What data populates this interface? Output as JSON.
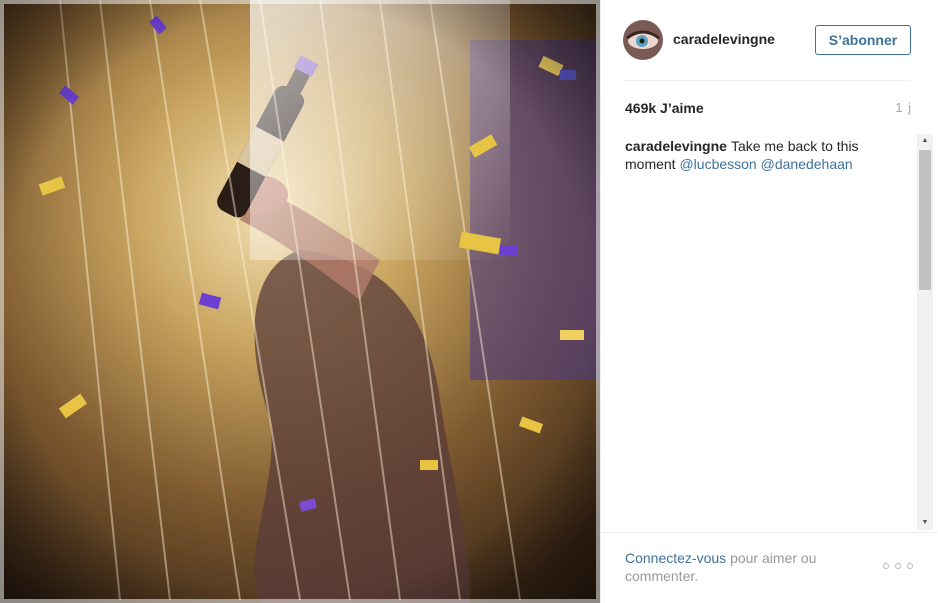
{
  "post": {
    "photo": {
      "icon": "party-photo",
      "description_visible": ""
    },
    "header": {
      "username": "caradelevingne",
      "follow_label": "S’abonner",
      "avatar_icon": "avatar-eye"
    },
    "stats": {
      "likes": "469k J’aime",
      "time": "1 j"
    },
    "caption": {
      "user": "caradelevingne",
      "text": "Take me back to this moment",
      "mentions": [
        "@lucbesson",
        "@danedehaan"
      ]
    },
    "footer": {
      "login_link": "Connectez-vous",
      "login_rest": "pour aimer ou commenter.",
      "more_icon": "more-options-icon"
    },
    "colors": {
      "link": "#3f729b",
      "text": "#262626",
      "muted": "#999999"
    }
  }
}
